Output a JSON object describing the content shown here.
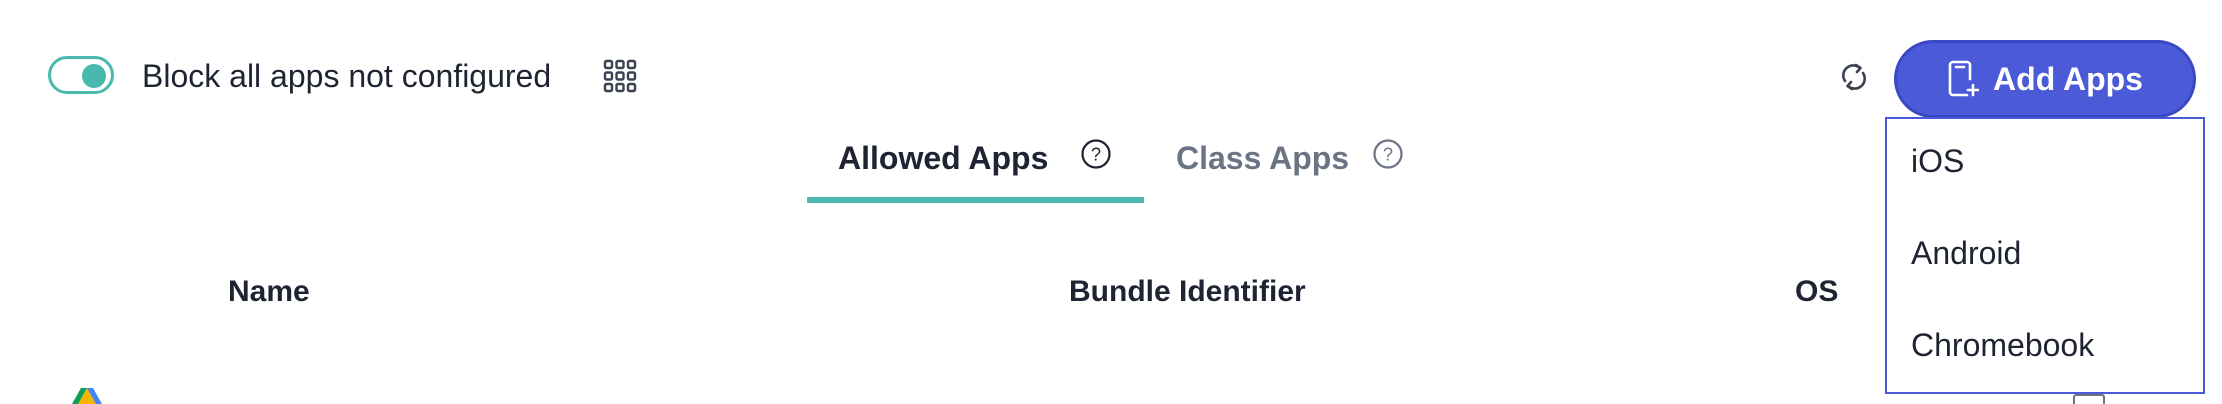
{
  "toolbar": {
    "block_toggle": {
      "label": "Block all apps not configured",
      "on": true
    },
    "grid_icon": "grid-icon",
    "refresh_icon": "refresh-icon",
    "add_apps_label": "Add Apps",
    "add_apps_icon": "add-device-icon"
  },
  "tabs": [
    {
      "label": "Allowed Apps",
      "active": true,
      "help_icon": "question-circle-icon"
    },
    {
      "label": "Class Apps",
      "active": false,
      "help_icon": "question-circle-icon"
    }
  ],
  "table": {
    "columns": [
      "Name",
      "Bundle Identifier",
      "OS"
    ]
  },
  "dropdown": {
    "items": [
      "iOS",
      "Android",
      "Chromebook"
    ]
  },
  "colors": {
    "accent": "#49b9ae",
    "primary": "#4b5ad6",
    "text": "#1f2433",
    "muted": "#6b7385"
  }
}
